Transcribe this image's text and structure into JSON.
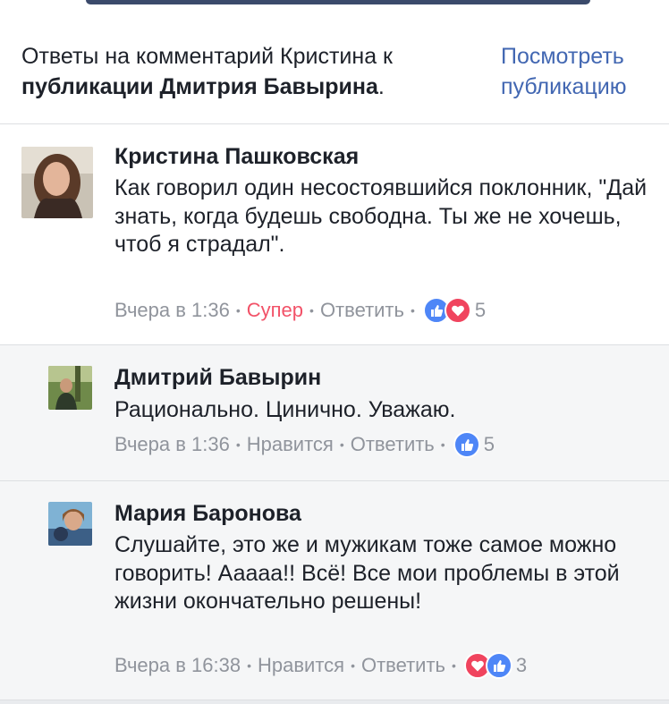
{
  "header": {
    "description_plain": "Ответы на комментарий Кристина к ",
    "description_bold": "публикации Дмитрия Бавырина",
    "description_end": ".",
    "view_link": "Посмотреть публикацию"
  },
  "comments": [
    {
      "author": "Кристина Пашковская",
      "text": "Как говорил один несостоявшийся поклонник, \"Дай знать, когда будешь свободна. Ты же не хочешь, чтоб я страдал\".",
      "time": "Вчера в 1:36",
      "like_label": "Супер",
      "reply_label": "Ответить",
      "reactions": [
        "like-icon",
        "love-icon"
      ],
      "reaction_count": "5"
    },
    {
      "author": "Дмитрий Бавырин",
      "text": "Рационально. Цинично. Уважаю.",
      "time": "Вчера в 1:36",
      "like_label": "Нравится",
      "reply_label": "Ответить",
      "reactions": [
        "like-icon"
      ],
      "reaction_count": "5"
    },
    {
      "author": "Мария Баронова",
      "text": "Слушайте, это же и мужикам тоже самое можно говорить! Ааааа!! Всё! Все мои проблемы в этой жизни окончательно решены!",
      "time": "Вчера в 16:38",
      "like_label": "Нравится",
      "reply_label": "Ответить",
      "reactions": [
        "love-icon",
        "like-icon"
      ],
      "reaction_count": "3"
    }
  ],
  "colors": {
    "link": "#4267b2",
    "super": "#f25268",
    "meta": "#90949c",
    "like": "#4e86f7",
    "love": "#f0445e"
  }
}
